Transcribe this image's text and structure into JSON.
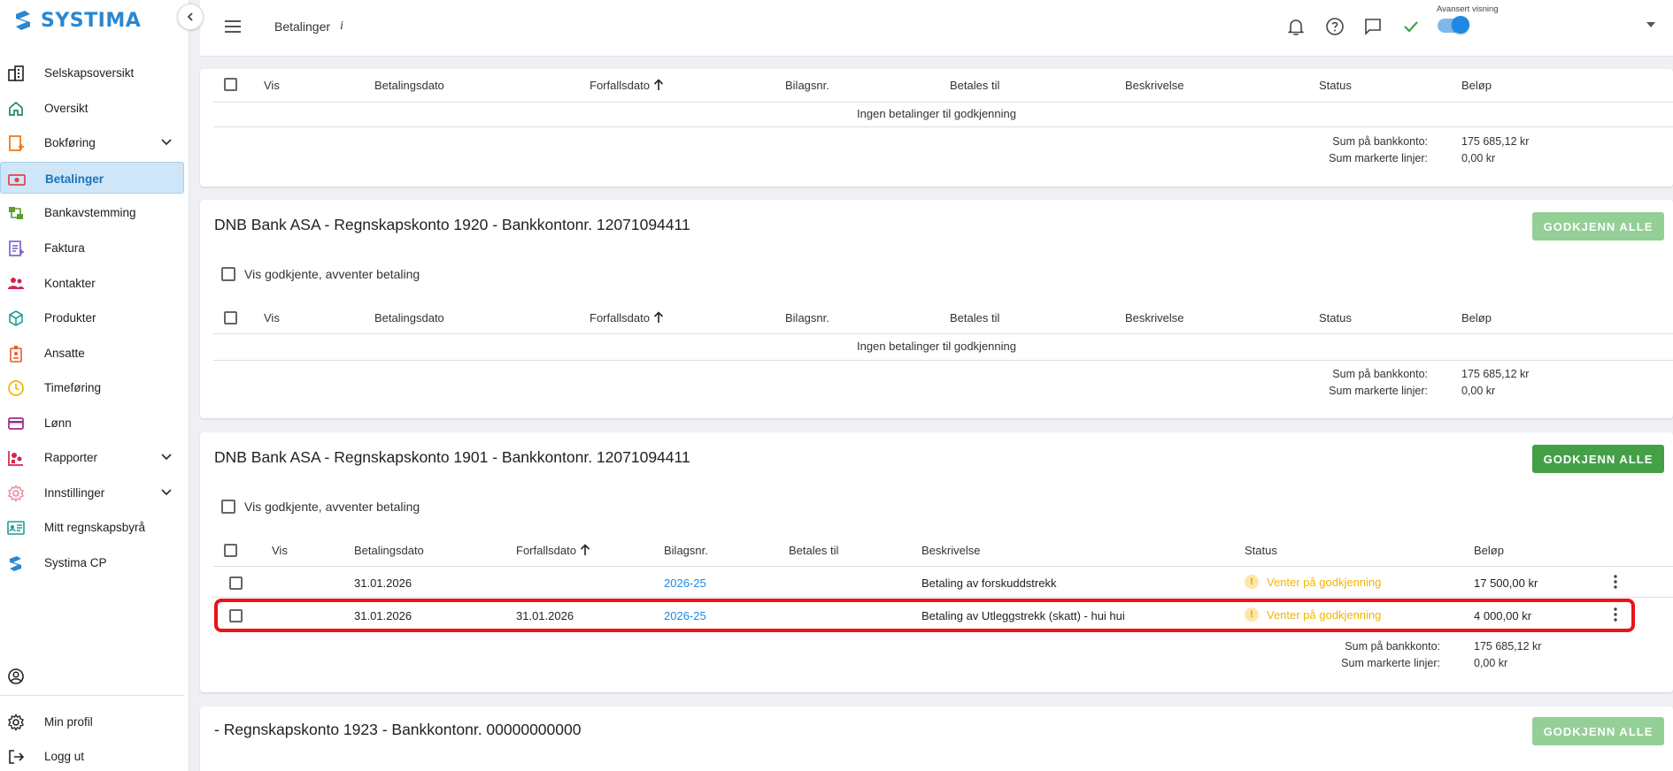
{
  "sidebar": {
    "logo": "SYSTIMA",
    "items": [
      {
        "label": "Selskapsoversikt",
        "icon": "buildings-icon"
      },
      {
        "label": "Oversikt",
        "icon": "home-icon"
      },
      {
        "label": "Bokføring",
        "icon": "ledger-icon"
      },
      {
        "label": "Betalinger",
        "icon": "money-icon"
      },
      {
        "label": "Bankavstemming",
        "icon": "bank-reconcile-icon"
      },
      {
        "label": "Faktura",
        "icon": "invoice-icon"
      },
      {
        "label": "Kontakter",
        "icon": "contacts-icon"
      },
      {
        "label": "Produkter",
        "icon": "cube-icon"
      },
      {
        "label": "Ansatte",
        "icon": "badge-icon"
      },
      {
        "label": "Timeføring",
        "icon": "clock-icon"
      },
      {
        "label": "Lønn",
        "icon": "card-icon"
      },
      {
        "label": "Rapporter",
        "icon": "chart-icon"
      },
      {
        "label": "Innstillinger",
        "icon": "gear-icon"
      },
      {
        "label": "Mitt regnskapsbyrå",
        "icon": "id-card-icon"
      },
      {
        "label": "Systima CP",
        "icon": "systima-icon"
      }
    ],
    "bottom": {
      "profile": "Min profil",
      "logout": "Logg ut"
    }
  },
  "topbar": {
    "title": "Betalinger",
    "info": "i",
    "advanced_label": "Avansert visning"
  },
  "table_headers": {
    "vis": "Vis",
    "betalingsdato": "Betalingsdato",
    "forfallsdato": "Forfallsdato",
    "bilagsnr": "Bilagsnr.",
    "betales_til": "Betales til",
    "beskrivelse": "Beskrivelse",
    "status": "Status",
    "belop": "Beløp"
  },
  "sections": [
    {
      "empty_message": "Ingen betalinger til godkjenning",
      "sum_bank_label": "Sum på bankkonto:",
      "sum_bank_value": "175 685,12 kr",
      "sum_marked_label": "Sum markerte linjer:",
      "sum_marked_value": "0,00 kr"
    },
    {
      "title": "DNB Bank ASA - Regnskapskonto 1920 - Bankkontonr. 12071094411",
      "approve_label": "GODKJENN ALLE",
      "show_approved_label": "Vis godkjente, avventer betaling",
      "empty_message": "Ingen betalinger til godkjenning",
      "sum_bank_label": "Sum på bankkonto:",
      "sum_bank_value": "175 685,12 kr",
      "sum_marked_label": "Sum markerte linjer:",
      "sum_marked_value": "0,00 kr"
    },
    {
      "title": "DNB Bank ASA - Regnskapskonto 1901 - Bankkontonr. 12071094411",
      "approve_label": "GODKJENN ALLE",
      "show_approved_label": "Vis godkjente, avventer betaling",
      "rows": [
        {
          "betalingsdato": "31.01.2026",
          "forfallsdato": "",
          "bilagsnr": "2026-25",
          "betales_til": "",
          "beskrivelse": "Betaling av forskuddstrekk",
          "status": "Venter på godkjenning",
          "belop": "17 500,00 kr"
        },
        {
          "betalingsdato": "31.01.2026",
          "forfallsdato": "31.01.2026",
          "bilagsnr": "2026-25",
          "betales_til": "",
          "beskrivelse": "Betaling av Utleggstrekk (skatt) - hui hui",
          "status": "Venter på godkjenning",
          "belop": "4 000,00 kr"
        }
      ],
      "sum_bank_label": "Sum på bankkonto:",
      "sum_bank_value": "175 685,12 kr",
      "sum_marked_label": "Sum markerte linjer:",
      "sum_marked_value": "0,00 kr"
    },
    {
      "title": "- Regnskapskonto 1923 - Bankkontonr. 00000000000",
      "approve_label": "GODKJENN ALLE"
    }
  ],
  "status_icon": "!",
  "colors": {
    "brand": "#2a87d0",
    "approve": "#43a047",
    "approve_disabled": "#93cf96",
    "pending": "#f5b400",
    "highlight": "#e8141a",
    "link": "#1e88e5"
  }
}
